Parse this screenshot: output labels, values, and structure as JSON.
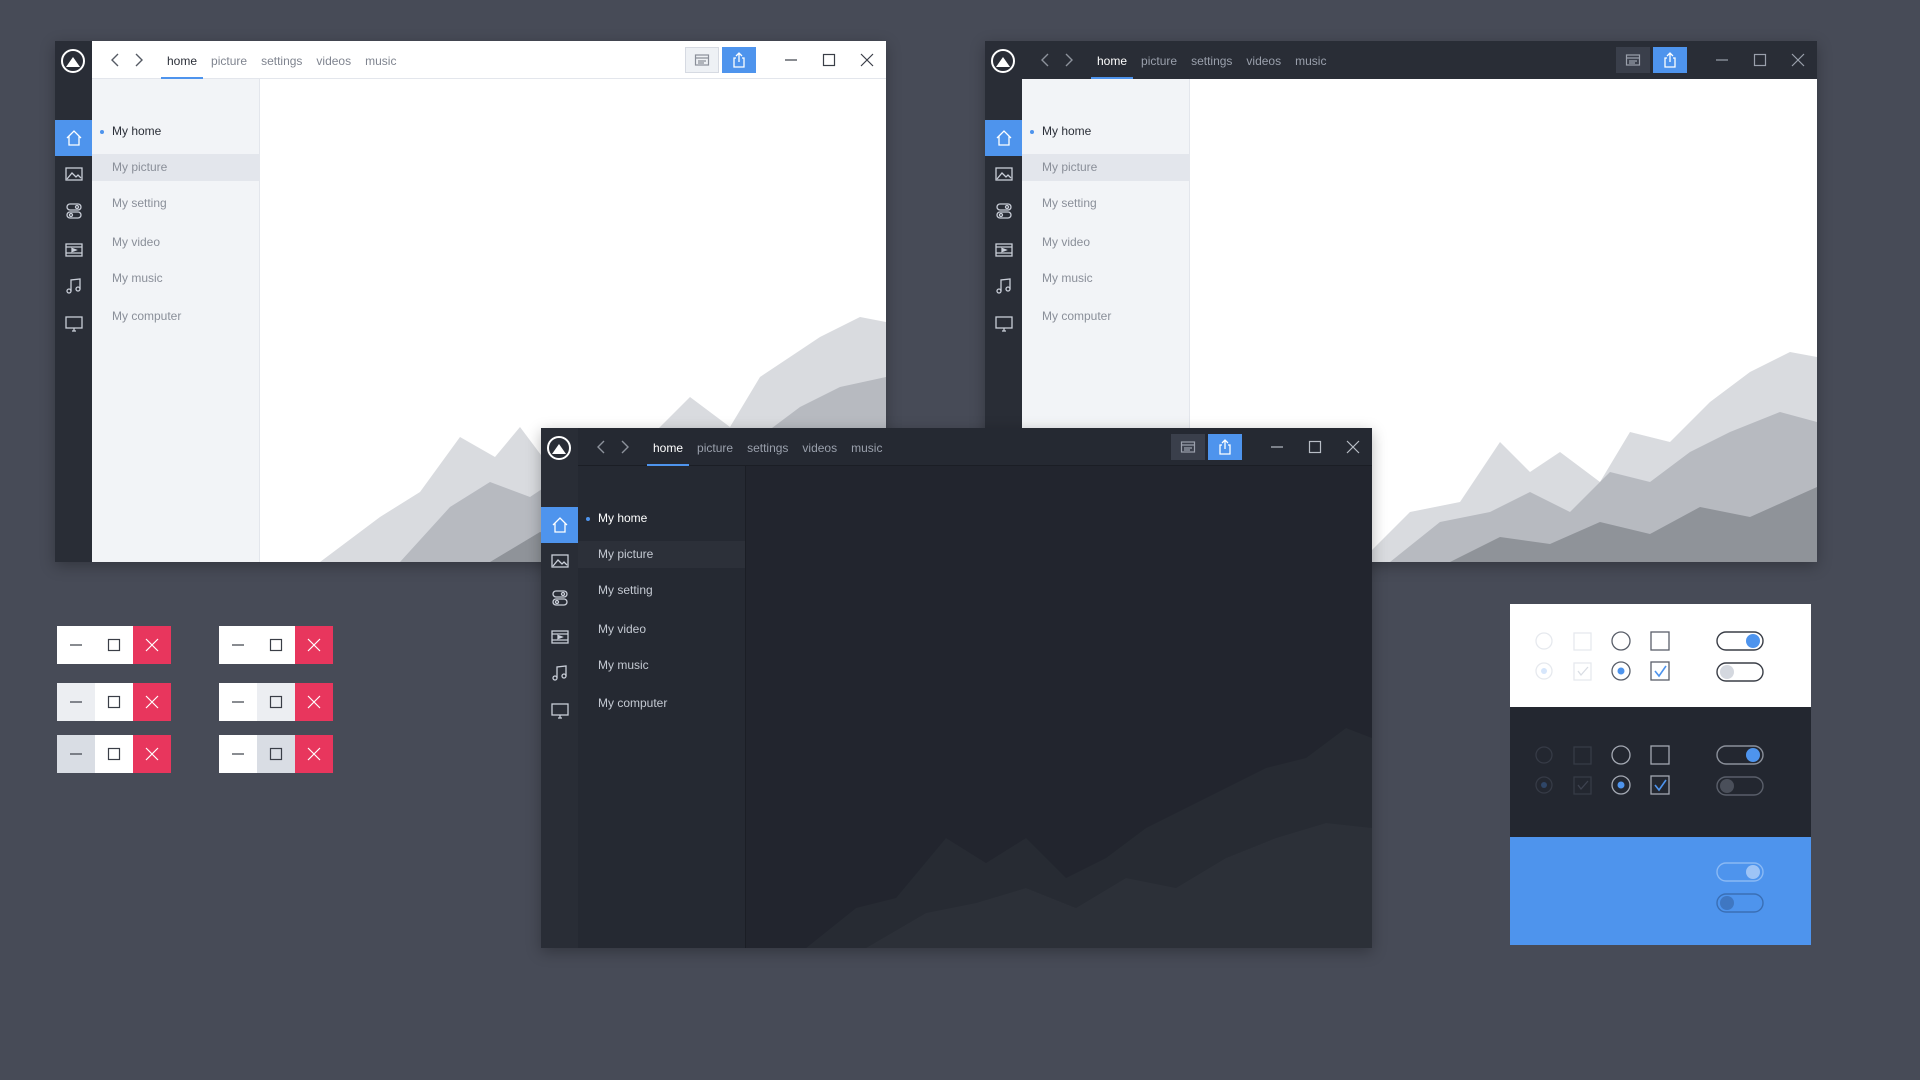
{
  "window": {
    "tabs": [
      "home",
      "picture",
      "settings",
      "videos",
      "music"
    ],
    "active_tab": "home",
    "menu": [
      "My home",
      "My picture",
      "My setting",
      "My video",
      "My music",
      "My computer"
    ],
    "active_menu": "My home",
    "hover_menu": "My picture",
    "rail_icons": [
      "home-icon",
      "picture-icon",
      "setting-icon",
      "video-icon",
      "music-icon",
      "computer-icon"
    ],
    "toolbar_icons": [
      "view-icon",
      "share-icon"
    ],
    "window_controls": [
      "minimize-icon",
      "maximize-icon",
      "close-icon"
    ]
  },
  "window_variants": [
    "light",
    "light-dark-header",
    "dark"
  ],
  "window_controls_states": [
    "normal",
    "hover-minimize",
    "pressed-minimize",
    "hover-maximize",
    "pressed-maximize"
  ],
  "colors": {
    "background": "#474b57",
    "accent": "#4e94ed",
    "close": "#e8365d",
    "rail": "#292d36",
    "dark_surface": "#22252e",
    "light_menu": "#f2f4f7"
  },
  "controls_panel": {
    "themes": [
      "light",
      "dark",
      "accent"
    ],
    "radio": [
      "unchecked",
      "checked"
    ],
    "checkbox": [
      "unchecked",
      "checked"
    ],
    "toggle": [
      "on",
      "off"
    ]
  }
}
